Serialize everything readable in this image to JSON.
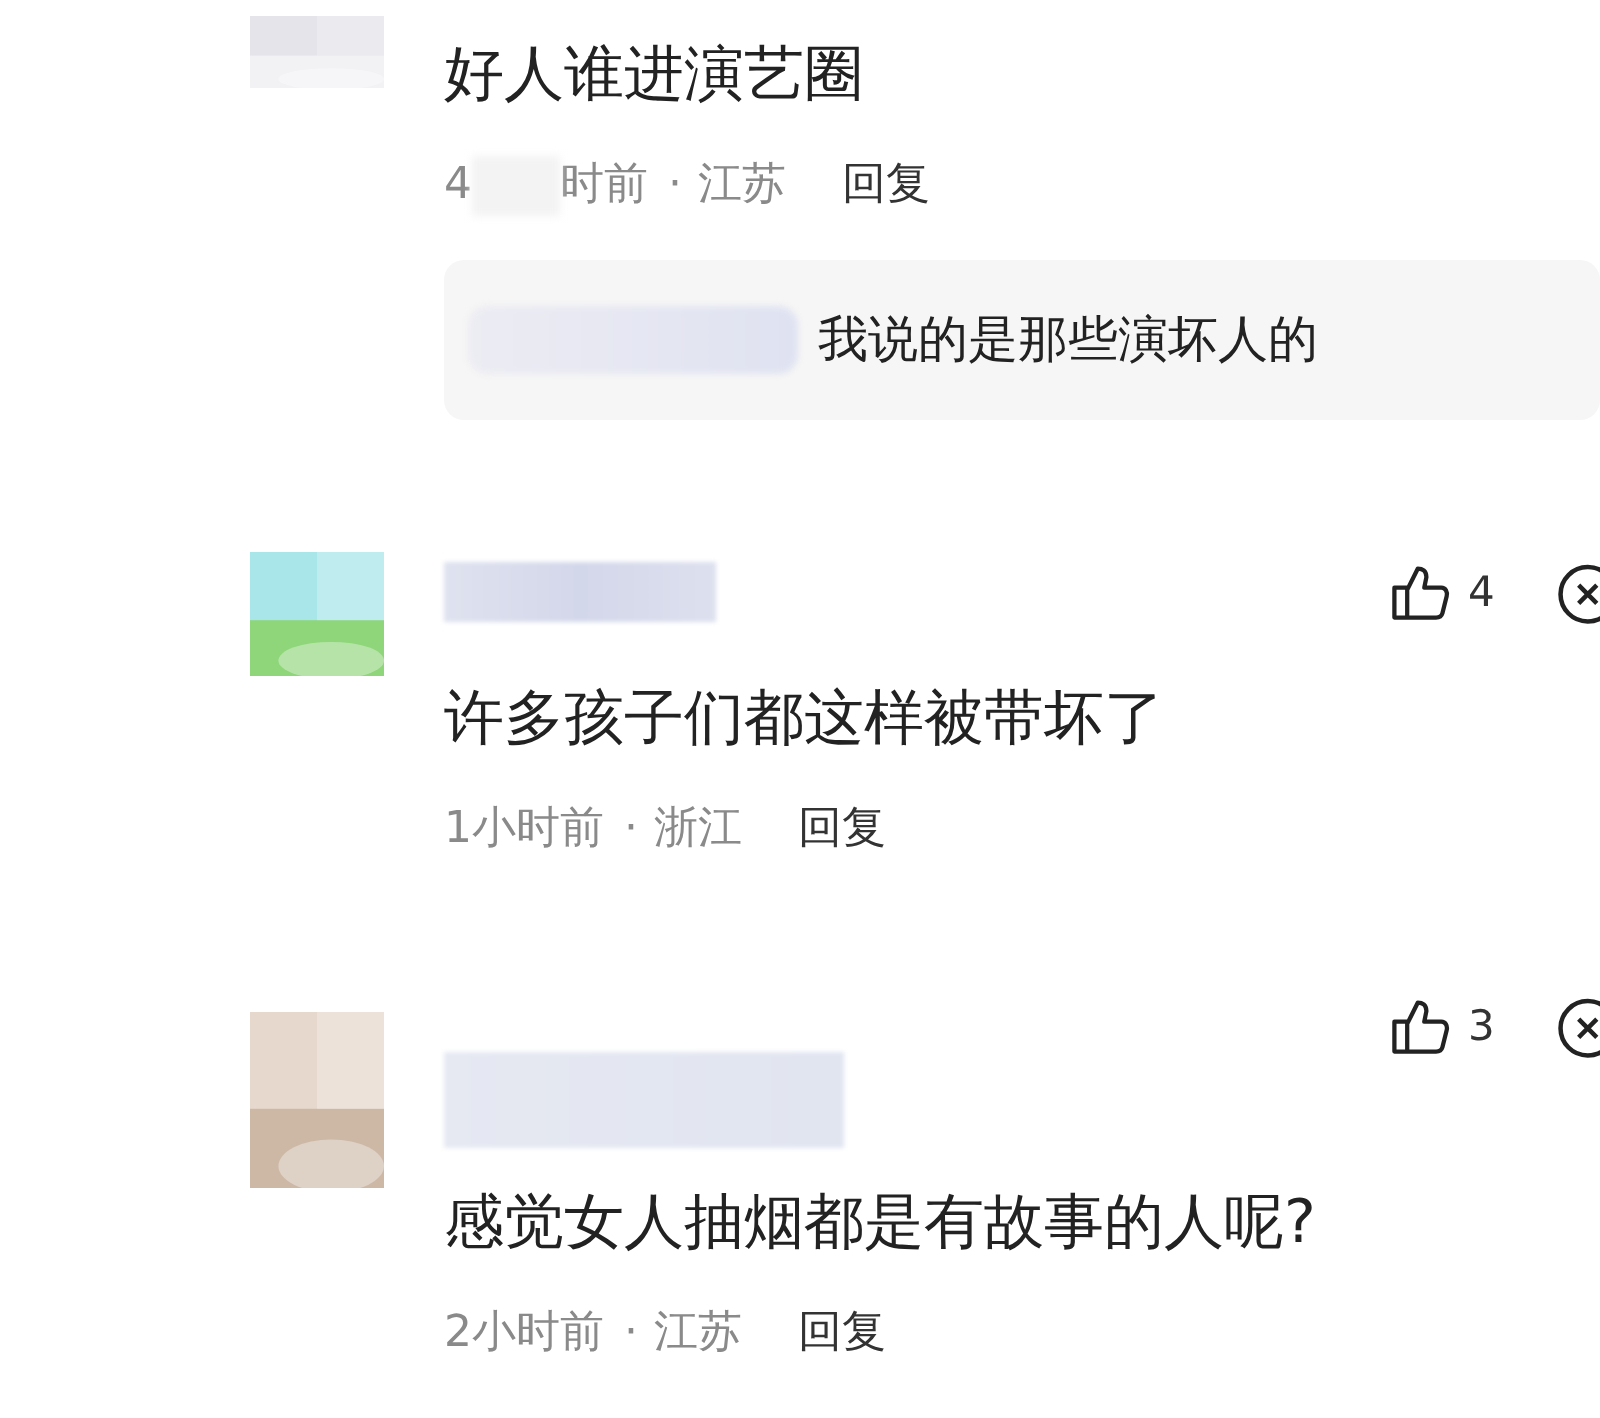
{
  "comments": [
    {
      "text": "好人谁进演艺圈",
      "time_fragments": [
        "4",
        "时前"
      ],
      "separator": "·",
      "location": "江苏",
      "reply_label": "回复",
      "replies": [
        {
          "text": "我说的是那些演坏人的"
        }
      ]
    },
    {
      "text": "许多孩子们都这样被带坏了",
      "time_fragments": [
        "1小时前"
      ],
      "separator": "·",
      "location": "浙江",
      "reply_label": "回复",
      "likes": "4"
    },
    {
      "text": "感觉女人抽烟都是有故事的人呢?",
      "time_fragments": [
        "2小时前"
      ],
      "separator": "·",
      "location": "江苏",
      "reply_label": "回复",
      "likes": "3"
    }
  ]
}
